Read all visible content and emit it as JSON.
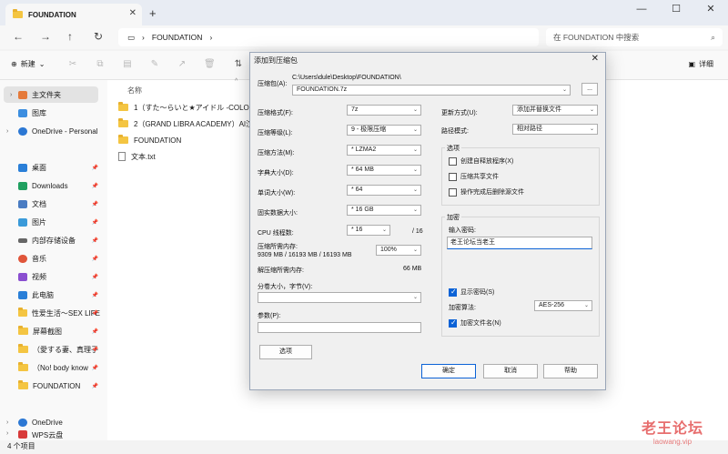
{
  "explorer": {
    "tab_title": "FOUNDATION",
    "tab_close": "✕",
    "new_tab": "+",
    "window_controls": [
      "—",
      "☐",
      "✕"
    ],
    "nav": {
      "back": "←",
      "forward": "→",
      "up": "↑",
      "refresh": "↻"
    },
    "address": {
      "monitor": "▭",
      "chev1": "›",
      "path": "FOUNDATION",
      "chev2": "›"
    },
    "search_placeholder": "在 FOUNDATION 中搜索",
    "search_icon": "⌕",
    "toolbar": {
      "new_label": "新建",
      "new_arrow": "⌄",
      "new_icon": "⊕",
      "sort_icon": "⇅",
      "details_label": "详细",
      "details_icon": "▣"
    },
    "sidebar": {
      "home": "主文件夹",
      "gallery": "图库",
      "onedrive_personal": "OneDrive - Personal",
      "desktop": "桌面",
      "downloads": "Downloads",
      "documents": "文档",
      "pictures": "图片",
      "internal_storage": "内部存储设备",
      "music": "音乐",
      "videos": "视频",
      "this_pc": "此电脑",
      "sex_life": "性爱生活～SEX LIFE",
      "screenshots": "屏幕截图",
      "folder_love": "（愛する妻、真理子",
      "folder_no": "（No! body know",
      "foundation": "FOUNDATION",
      "onedrive": "OneDrive",
      "wps": "WPS云盘",
      "chev_closed": "›",
      "chev_open": "⌄",
      "pin": "📌"
    },
    "column_name": "名称",
    "column_sort": "^",
    "files": [
      "1（すた～らいと★アイドル -COLORFUL",
      "2（GRAND LIBRA ACADEMY）AI汉化",
      "FOUNDATION",
      "文本.txt"
    ],
    "status": "4 个项目"
  },
  "watermark": {
    "title": "老王论坛",
    "sub": "laowang.vip"
  },
  "dialog": {
    "title": "添加到压缩包",
    "close": "✕",
    "archive_label": "压缩包(A):",
    "archive_dir": "C:\\Users\\dule\\Desktop\\FOUNDATION\\",
    "archive_name": "FOUNDATION.7z",
    "browse": "...",
    "format_label": "压缩格式(F):",
    "format_value": "7z",
    "level_label": "压缩等级(L):",
    "level_value": "9 - 极限压缩",
    "method_label": "压缩方法(M):",
    "method_value": "* LZMA2",
    "dict_label": "字典大小(D):",
    "dict_value": "* 64 MB",
    "word_label": "单词大小(W):",
    "word_value": "* 64",
    "solid_label": "固实数据大小:",
    "solid_value": "* 16 GB",
    "threads_label": "CPU 线程数:",
    "threads_value": "* 16",
    "threads_max": "/ 16",
    "mem_label": "压缩所需内存:",
    "mem_value": "9309 MB / 16193 MB / 16193 MB",
    "mem_pct": "100%",
    "decomp_label": "解压缩所需内存:",
    "decomp_value": "66 MB",
    "split_label": "分卷大小，字节(V):",
    "params_label": "参数(P):",
    "options_button": "选项",
    "update_label": "更新方式(U):",
    "update_value": "添加并替换文件",
    "path_label": "路径模式:",
    "path_value": "相对路径",
    "options_group": "选项",
    "opt_sfx": "创建自释放程序(X)",
    "opt_shared": "压缩共享文件",
    "opt_delete": "操作完成后删除源文件",
    "enc_group": "加密",
    "pwd_label": "输入密码:",
    "pwd_value": "老王论坛当老王",
    "show_pwd": "显示密码(S)",
    "enc_method_label": "加密算法:",
    "enc_method_value": "AES-256",
    "enc_names": "加密文件名(N)",
    "ok": "确定",
    "cancel": "取消",
    "help": "帮助",
    "dropdown": "⌄"
  }
}
